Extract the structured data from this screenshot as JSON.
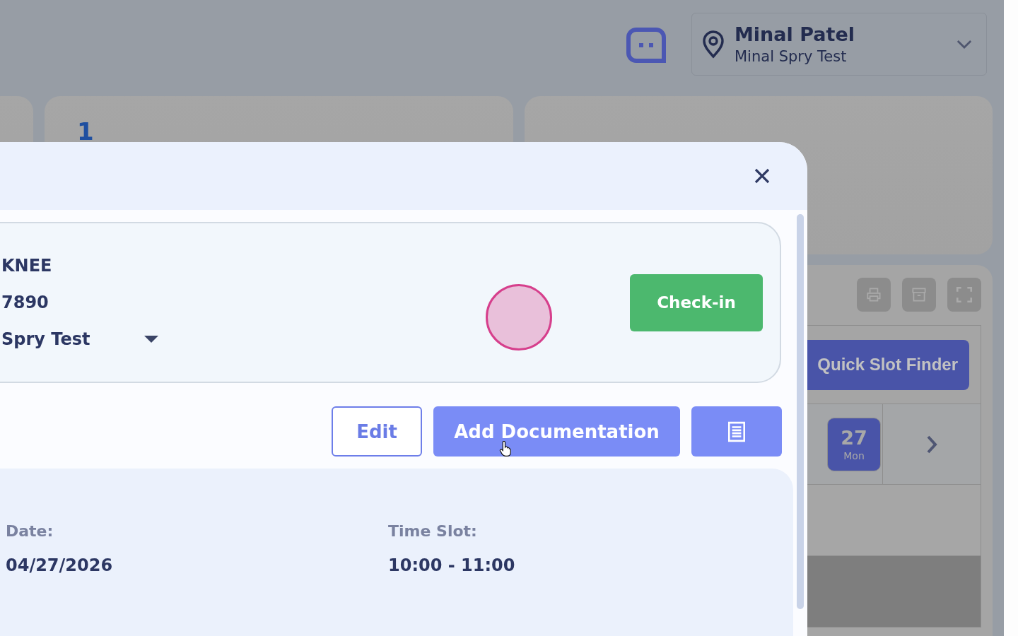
{
  "header": {
    "user_name": "Minal Patel",
    "location": "Minal Spry Test"
  },
  "background": {
    "stat_value": "1",
    "quick_slot_button": "Quick Slot Finder",
    "day": {
      "number": "27",
      "weekday": "Mon",
      "selected": true
    }
  },
  "modal": {
    "patient": {
      "line_1": "KNEE",
      "line_2": "7890",
      "location": "Spry Test"
    },
    "check_in_button": "Check-in",
    "actions": [
      {
        "kind": "outline",
        "label": "Edit"
      },
      {
        "kind": "filled",
        "label": "Add Documentation"
      }
    ],
    "details": [
      {
        "label": "Date:",
        "value": "04/27/2026"
      },
      {
        "label": "Time Slot:",
        "value": "10:00 - 11:00"
      }
    ]
  }
}
